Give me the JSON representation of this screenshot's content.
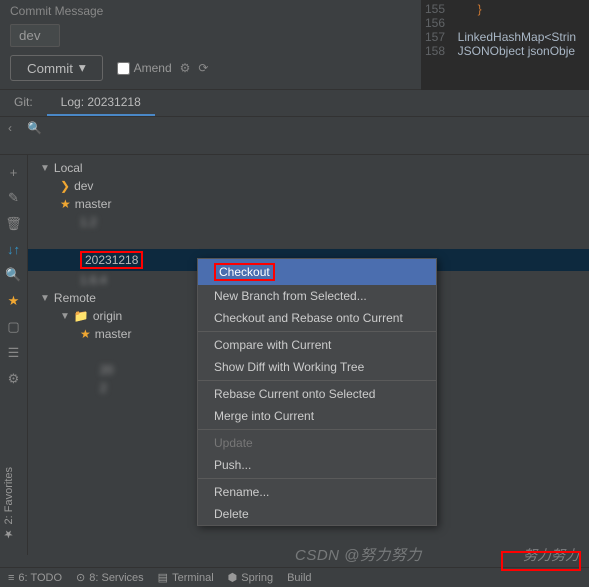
{
  "commit_panel": {
    "title": "Commit Message",
    "input_value": "dev",
    "commit_button": "Commit",
    "amend_label": "Amend"
  },
  "editor": {
    "lines": [
      "155",
      "156",
      "157",
      "158"
    ],
    "brace": "}",
    "code1": "LinkedHashMap<Strin",
    "code2": "JSONObject jsonObje"
  },
  "tabs": {
    "git": "Git:",
    "log": "Log: 20231218"
  },
  "search": {
    "placeholder": ""
  },
  "tree": {
    "local": "Local",
    "dev": "dev",
    "master": "master",
    "blur1": "1.2",
    "selected_branch": "20231218",
    "blur2": "1.6.4",
    "remote": "Remote",
    "origin": "origin",
    "remote_master": "master",
    "blur3": "20",
    "blur4": "2"
  },
  "context_menu": {
    "checkout": "Checkout",
    "new_branch": "New Branch from Selected...",
    "checkout_rebase": "Checkout and Rebase onto Current",
    "compare": "Compare with Current",
    "show_diff": "Show Diff with Working Tree",
    "rebase": "Rebase Current onto Selected",
    "merge": "Merge into Current",
    "update": "Update",
    "push": "Push...",
    "rename": "Rename...",
    "delete": "Delete"
  },
  "bottom": {
    "todo": "6: TODO",
    "services": "8: Services",
    "terminal": "Terminal",
    "spring": "Spring",
    "build": "Build"
  },
  "sideways": "2: Favorites",
  "watermark": "CSDN @努力努力",
  "watermark2": "努力努力"
}
